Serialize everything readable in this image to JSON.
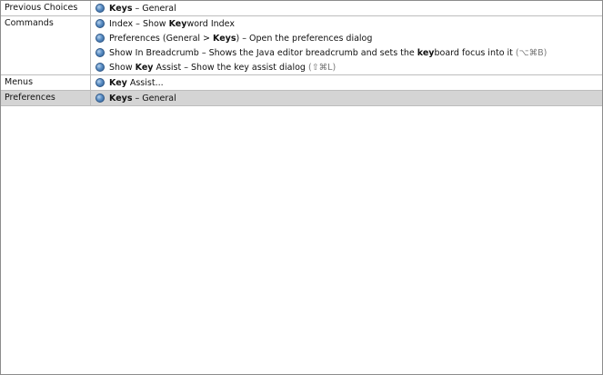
{
  "popup": {
    "sections": [
      {
        "category": "Previous Choices",
        "items": [
          {
            "keys": "Keys",
            "rest": " – General"
          }
        ]
      },
      {
        "category": "Commands",
        "items": [
          {
            "pre": "Index – Show ",
            "bold": "Key",
            "post": "word Index"
          },
          {
            "pre": "Preferences (General > ",
            "bold": "Keys",
            "post": ") – Open the preferences dialog"
          },
          {
            "pre": "Show In Breadcrumb – Shows the Java editor breadcrumb and sets the ",
            "bold": "key",
            "post": "board focus into it",
            "shortcut": "(⌥⌘B)"
          },
          {
            "pre": "Show ",
            "bold": "Key",
            "post": " Assist – Show the key assist dialog ",
            "shortcut": "(⇧⌘L)"
          }
        ]
      },
      {
        "category": "Menus",
        "items": [
          {
            "keys": "Key",
            "rest": " Assist..."
          }
        ]
      },
      {
        "category": "Preferences",
        "items": [
          {
            "keys": "Keys",
            "rest": " – General"
          }
        ]
      }
    ]
  },
  "icons": {
    "item_icon": "blue-bullet-icon"
  },
  "colors": {
    "selection": "#d4d4d4",
    "bullet": "#5b8ec4"
  }
}
